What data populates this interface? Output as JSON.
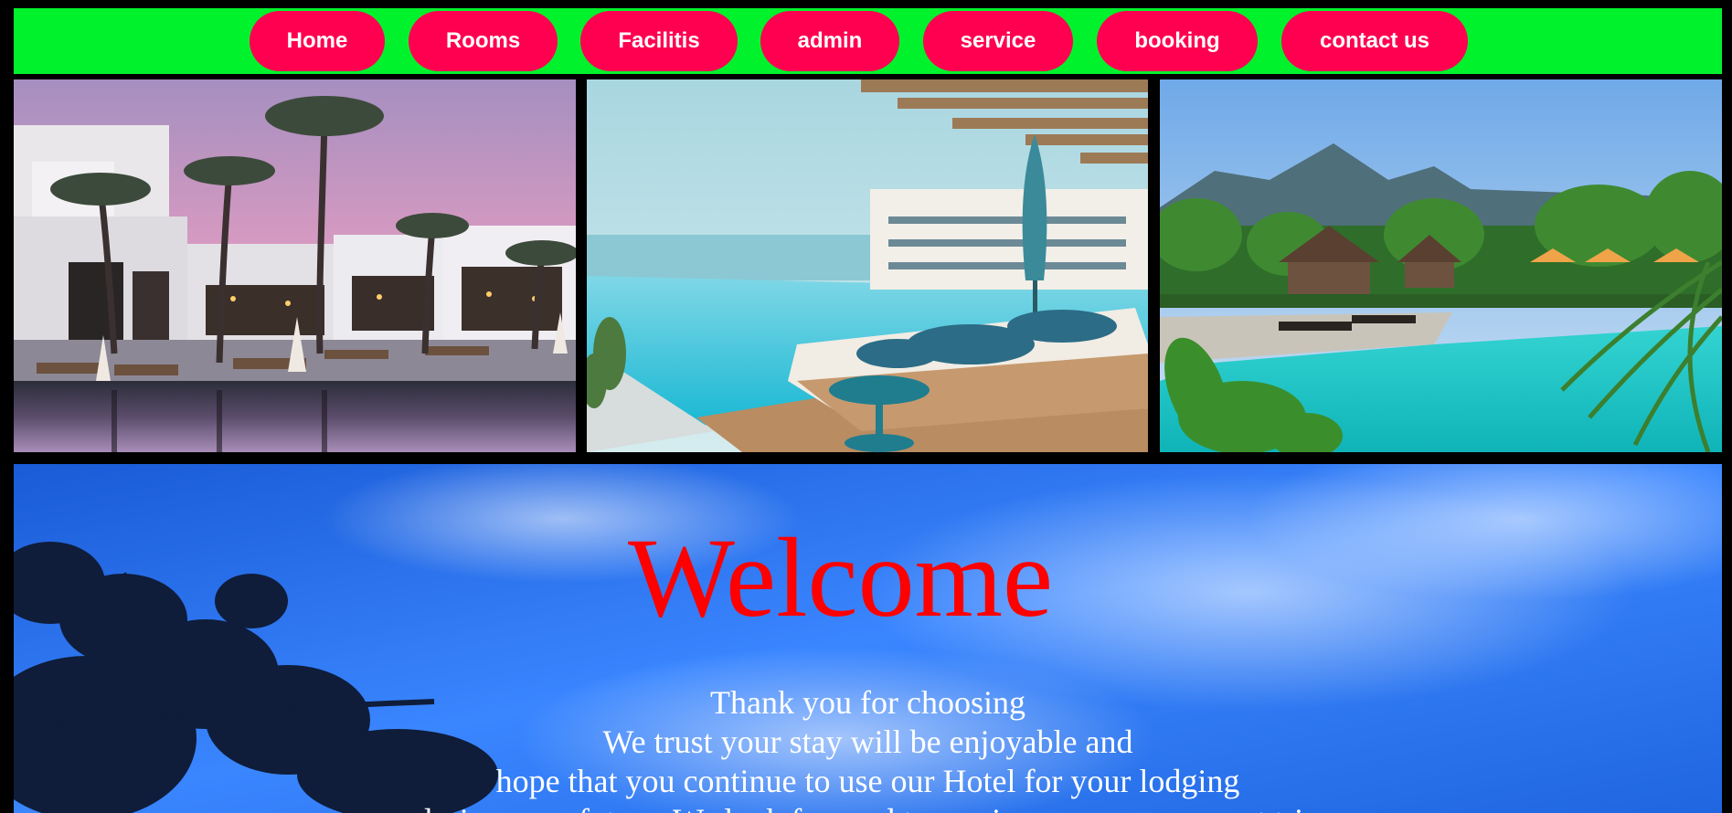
{
  "nav": {
    "items": [
      {
        "label": "Home"
      },
      {
        "label": "Rooms"
      },
      {
        "label": "Facilitis"
      },
      {
        "label": "admin"
      },
      {
        "label": "service"
      },
      {
        "label": "booking"
      },
      {
        "label": "contact us"
      }
    ]
  },
  "photos": [
    {
      "subject": "resort pool at dusk with palm trees"
    },
    {
      "subject": "infinity pool with sun loungers and sea view"
    },
    {
      "subject": "tropical pool villa with limestone mountains"
    }
  ],
  "hero": {
    "title": "Welcome",
    "lines": [
      "Thank you for choosing",
      "We trust your stay will be enjoyable and",
      "hope that you continue to use our Hotel for your lodging",
      "during your future. We look forward to serving you on your next trip"
    ]
  },
  "colors": {
    "nav_bar": "#00f22d",
    "nav_button": "#ff0050",
    "nav_text": "#ffffff",
    "title": "#ff0000",
    "message_text": "#ffffff",
    "sky": "#2a7bff"
  }
}
